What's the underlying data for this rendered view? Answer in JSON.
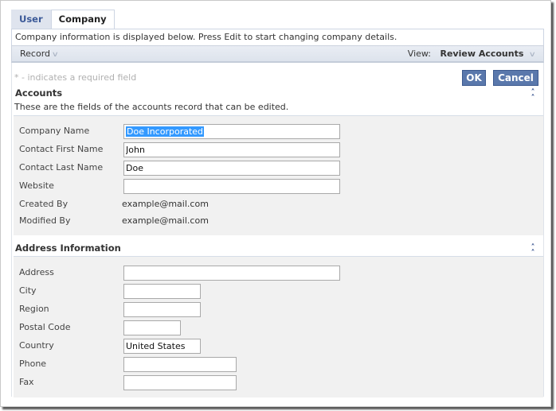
{
  "tabs": [
    {
      "label": "User",
      "active": false
    },
    {
      "label": "Company",
      "active": true
    }
  ],
  "description": "Company information is displayed below. Press Edit to start changing company details.",
  "toolbar": {
    "record_label": "Record",
    "view_label": "View:",
    "view_value": "Review Accounts"
  },
  "required_note": "* - indicates a required field",
  "buttons": {
    "ok": "OK",
    "cancel": "Cancel"
  },
  "accounts": {
    "title": "Accounts",
    "description": "These are the fields of the accounts record that can be edited.",
    "fields": {
      "company_name": {
        "label": "Company Name",
        "value": "Doe Incorporated"
      },
      "contact_first_name": {
        "label": "Contact First Name",
        "value": "John"
      },
      "contact_last_name": {
        "label": "Contact Last Name",
        "value": "Doe"
      },
      "website": {
        "label": "Website",
        "value": ""
      },
      "created_by": {
        "label": "Created By",
        "value": "example@mail.com"
      },
      "modified_by": {
        "label": "Modified By",
        "value": "example@mail.com"
      }
    }
  },
  "address": {
    "title": "Address Information",
    "fields": {
      "address": {
        "label": "Address",
        "value": ""
      },
      "city": {
        "label": "City",
        "value": ""
      },
      "region": {
        "label": "Region",
        "value": ""
      },
      "postal_code": {
        "label": "Postal Code",
        "value": ""
      },
      "country": {
        "label": "Country",
        "value": "United States"
      },
      "phone": {
        "label": "Phone",
        "value": ""
      },
      "fax": {
        "label": "Fax",
        "value": ""
      }
    }
  },
  "icons": {
    "chevron_down": "∨",
    "collapse": "˄\n˄"
  },
  "colors": {
    "button_bg": "#5a78ac",
    "tab_inactive_text": "#3b5998",
    "selection": "#3399ff",
    "collapse_icon": "#1f3e82"
  }
}
